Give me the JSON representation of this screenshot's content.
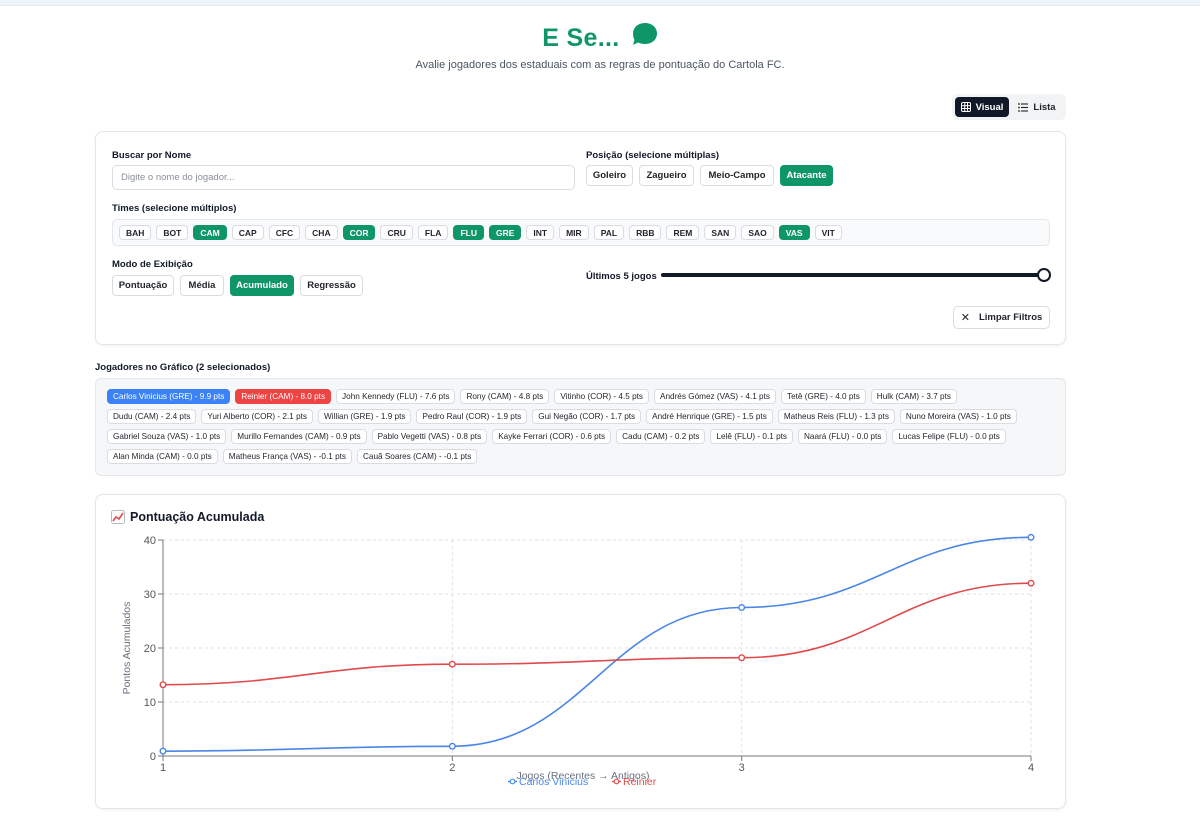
{
  "header": {
    "title": "E Se...",
    "subtitle": "Avalie jogadores dos estaduais com as regras de pontuação do Cartola FC."
  },
  "view_toggle": {
    "visual_label": "Visual",
    "list_label": "Lista",
    "active": "Visual"
  },
  "filters": {
    "search_label": "Buscar por Nome",
    "search_placeholder": "Digite o nome do jogador...",
    "search_value": "",
    "position_label": "Posição (selecione múltiplas)",
    "positions": [
      {
        "label": "Goleiro",
        "active": false
      },
      {
        "label": "Zagueiro",
        "active": false
      },
      {
        "label": "Meio-Campo",
        "active": false
      },
      {
        "label": "Atacante",
        "active": true
      }
    ],
    "teams_label": "Times (selecione múltiplos)",
    "teams": [
      {
        "label": "BAH",
        "active": false
      },
      {
        "label": "BOT",
        "active": false
      },
      {
        "label": "CAM",
        "active": true
      },
      {
        "label": "CAP",
        "active": false
      },
      {
        "label": "CFC",
        "active": false
      },
      {
        "label": "CHA",
        "active": false
      },
      {
        "label": "COR",
        "active": true
      },
      {
        "label": "CRU",
        "active": false
      },
      {
        "label": "FLA",
        "active": false
      },
      {
        "label": "FLU",
        "active": true
      },
      {
        "label": "GRE",
        "active": true
      },
      {
        "label": "INT",
        "active": false
      },
      {
        "label": "MIR",
        "active": false
      },
      {
        "label": "PAL",
        "active": false
      },
      {
        "label": "RBB",
        "active": false
      },
      {
        "label": "REM",
        "active": false
      },
      {
        "label": "SAN",
        "active": false
      },
      {
        "label": "SAO",
        "active": false
      },
      {
        "label": "VAS",
        "active": true
      },
      {
        "label": "VIT",
        "active": false
      }
    ],
    "mode_label": "Modo de Exibição",
    "modes": [
      {
        "label": "Pontuação",
        "active": false
      },
      {
        "label": "Média",
        "active": false
      },
      {
        "label": "Acumulado",
        "active": true
      },
      {
        "label": "Regressão",
        "active": false
      }
    ],
    "games_label": "Últimos 5 jogos",
    "games_slider_fraction": 1.0,
    "clear_label": "Limpar Filtros"
  },
  "players": {
    "title": "Jogadores no Gráfico (2 selecionados)",
    "rows": [
      [
        {
          "label": "Carlos Vinicius (GRE) - 9.9 pts",
          "state": "blue"
        },
        {
          "label": "Reinier (CAM) - 8.0 pts",
          "state": "red"
        },
        {
          "label": "John Kennedy (FLU) - 7.6 pts",
          "state": ""
        },
        {
          "label": "Rony (CAM) - 4.8 pts",
          "state": ""
        },
        {
          "label": "Vitinho (COR) - 4.5 pts",
          "state": ""
        },
        {
          "label": "Andrés Gómez (VAS) - 4.1 pts",
          "state": ""
        },
        {
          "label": "Tetê (GRE) - 4.0 pts",
          "state": ""
        },
        {
          "label": "Hulk (CAM) - 3.7 pts",
          "state": ""
        }
      ],
      [
        {
          "label": "Dudu (CAM) - 2.4 pts",
          "state": ""
        },
        {
          "label": "Yuri Alberto (COR) - 2.1 pts",
          "state": ""
        },
        {
          "label": "Willian (GRE) - 1.9 pts",
          "state": ""
        },
        {
          "label": "Pedro Raul (COR) - 1.9 pts",
          "state": ""
        },
        {
          "label": "Gui Negão (COR) - 1.7 pts",
          "state": ""
        },
        {
          "label": "André Henrique (GRE) - 1.5 pts",
          "state": ""
        },
        {
          "label": "Matheus Reis (FLU) - 1.3 pts",
          "state": ""
        },
        {
          "label": "Nuno Moreira (VAS) - 1.0 pts",
          "state": ""
        }
      ],
      [
        {
          "label": "Gabriel Souza (VAS) - 1.0 pts",
          "state": ""
        },
        {
          "label": "Murillo Fernandes (CAM) - 0.9 pts",
          "state": ""
        },
        {
          "label": "Pablo Vegetti (VAS) - 0.8 pts",
          "state": ""
        },
        {
          "label": "Kayke Ferrari (COR) - 0.6 pts",
          "state": ""
        },
        {
          "label": "Cadu (CAM) - 0.2 pts",
          "state": ""
        },
        {
          "label": "Lelê (FLU) - 0.1 pts",
          "state": ""
        },
        {
          "label": "Naará (FLU) - 0.0 pts",
          "state": ""
        },
        {
          "label": "Lucas Felipe (FLU) - 0.0 pts",
          "state": ""
        }
      ],
      [
        {
          "label": "Alan Minda (CAM) - 0.0 pts",
          "state": ""
        },
        {
          "label": "Matheus França (VAS) - -0.1 pts",
          "state": ""
        },
        {
          "label": "Cauã Soares (CAM) - -0.1 pts",
          "state": ""
        }
      ]
    ]
  },
  "chart": {
    "icon": "chart-increasing-icon",
    "title": "Pontuação Acumulada"
  },
  "chart_data": {
    "type": "line",
    "x": [
      1,
      2,
      3,
      4
    ],
    "xlabel": "Jogos (Recentes → Antigos)",
    "ylabel": "Pontos Acumulados",
    "ylim": [
      0,
      40
    ],
    "yticks": [
      0,
      10,
      20,
      30,
      40
    ],
    "grid": true,
    "legend": "bottom",
    "series": [
      {
        "name": "Carlos Vinicius",
        "color": "#4a86e8",
        "values": [
          0.9,
          1.8,
          27.5,
          40.5
        ]
      },
      {
        "name": "Reinier",
        "color": "#e04a4a",
        "values": [
          13.2,
          17.0,
          18.2,
          32.0
        ]
      }
    ]
  },
  "colors": {
    "brand": "#0f9668",
    "dark": "#111827"
  }
}
